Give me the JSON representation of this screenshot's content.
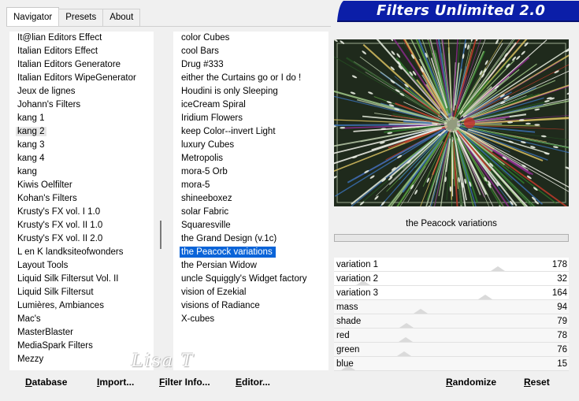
{
  "app": {
    "title": "Filters Unlimited 2.0",
    "colors": {
      "banner_bg": "#0b1ea8",
      "banner_text": "#ffffff",
      "selection": "#0a64d8"
    }
  },
  "tabs": [
    {
      "label": "Navigator",
      "active": true
    },
    {
      "label": "Presets",
      "active": false
    },
    {
      "label": "About",
      "active": false
    }
  ],
  "categories": {
    "selected": "kang 2",
    "items": [
      "It@lian Editors Effect",
      "Italian Editors Effect",
      "Italian Editors Generatore",
      "Italian Editors WipeGenerator",
      "Jeux de lignes",
      "Johann's Filters",
      "kang 1",
      "kang 2",
      "kang 3",
      "kang 4",
      "kang",
      "Kiwis Oelfilter",
      "Kohan's Filters",
      "Krusty's FX vol. I 1.0",
      "Krusty's FX vol. II 1.0",
      "Krusty's FX vol. II 2.0",
      "L en K landksiteofwonders",
      "Layout Tools",
      "Liquid Silk Filtersut Vol. II",
      "Liquid Silk Filtersut",
      "Lumières, Ambiances",
      "Mac's",
      "MasterBlaster",
      "MediaSpark Filters",
      "Mezzy"
    ]
  },
  "filters": {
    "selected": "the Peacock variations",
    "items": [
      "color Cubes",
      "cool Bars",
      "Drug #333",
      "either the Curtains go or I do !",
      "Houdini is only Sleeping",
      "iceCream Spiral",
      "Iridium Flowers",
      "keep Color--invert Light",
      "luxury Cubes",
      "Metropolis",
      "mora-5 Orb",
      "mora-5",
      "shineeboxez",
      "solar Fabric",
      "Squaresville",
      "the Grand Design     (v.1c)",
      "the Peacock variations",
      "the Persian Widow",
      "uncle Squiggly's Widget factory",
      "vision of Ezekial",
      "visions of Radiance",
      "X-cubes"
    ]
  },
  "preview": {
    "filter_name": "the Peacock variations"
  },
  "parameters": [
    {
      "label": "variation 1",
      "value": "178",
      "fraction": 0.698
    },
    {
      "label": "variation 2",
      "value": "32",
      "fraction": 0.125
    },
    {
      "label": "variation 3",
      "value": "164",
      "fraction": 0.643
    },
    {
      "label": "mass",
      "value": "94",
      "fraction": 0.369
    },
    {
      "label": "shade",
      "value": "79",
      "fraction": 0.31
    },
    {
      "label": "red",
      "value": "78",
      "fraction": 0.306
    },
    {
      "label": "green",
      "value": "76",
      "fraction": 0.298
    },
    {
      "label": "blue",
      "value": "15",
      "fraction": 0.059
    }
  ],
  "buttons": {
    "database": {
      "label_u": "D",
      "label_rest": "atabase"
    },
    "import": {
      "label_u": "I",
      "label_rest": "mport..."
    },
    "filter_info": {
      "label_u": "F",
      "label_rest": "ilter Info..."
    },
    "editor": {
      "label_u": "E",
      "label_rest": "ditor..."
    },
    "randomize": {
      "label_u": "R",
      "label_rest": "andomize"
    },
    "reset": {
      "label_u": "R",
      "label_rest": "eset"
    }
  },
  "watermark": {
    "text": "Lisa T"
  }
}
